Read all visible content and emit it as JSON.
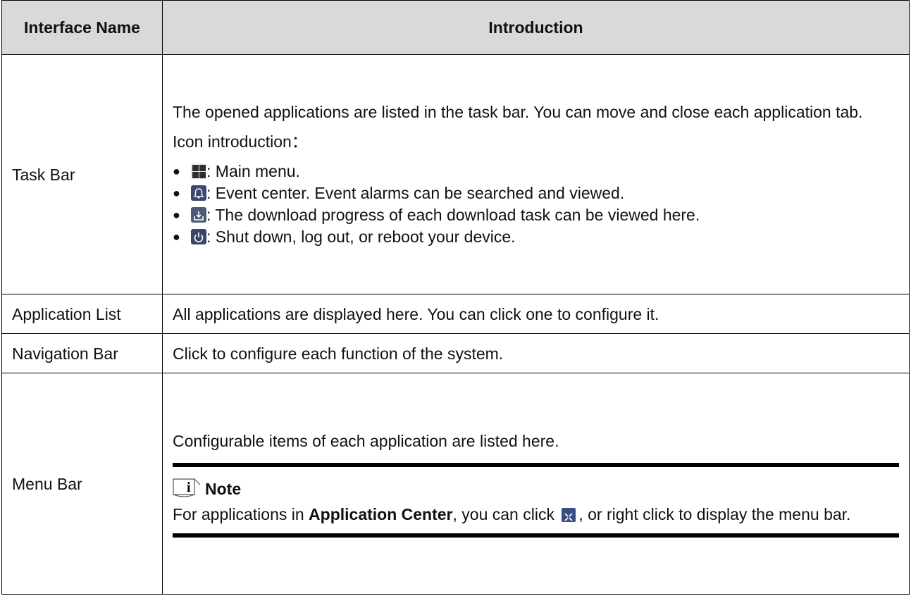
{
  "table": {
    "headers": {
      "name": "Interface Name",
      "intro": "Introduction"
    },
    "rows": {
      "task_bar": {
        "name": "Task Bar",
        "para1": "The opened applications are listed in the task bar. You can move and close each application tab.",
        "para2": "Icon introduction：",
        "icons": [
          {
            "icon": "main-menu-icon",
            "text": ": Main menu."
          },
          {
            "icon": "event-center-icon",
            "text": ": Event center. Event alarms can be searched and viewed."
          },
          {
            "icon": "download-icon",
            "text": ": The download progress of each download task can be viewed here."
          },
          {
            "icon": "power-icon",
            "text": ": Shut down, log out, or reboot your device."
          }
        ],
        "bullet": "●"
      },
      "app_list": {
        "name": "Application List",
        "text": "All applications are displayed here. You can click one to configure it."
      },
      "nav_bar": {
        "name": "Navigation Bar",
        "text": "Click to configure each function of the system."
      },
      "menu_bar": {
        "name": "Menu Bar",
        "text": "Configurable items of each application are listed here.",
        "note_title": "Note",
        "note_prefix": "For applications in ",
        "note_bold": "Application Center",
        "note_mid": ", you can click ",
        "note_suffix": ", or right click to display the menu bar."
      }
    }
  },
  "colors": {
    "header_bg": "#d9d9d9",
    "border": "#000000",
    "icon_dark": "#3b4a6b"
  }
}
